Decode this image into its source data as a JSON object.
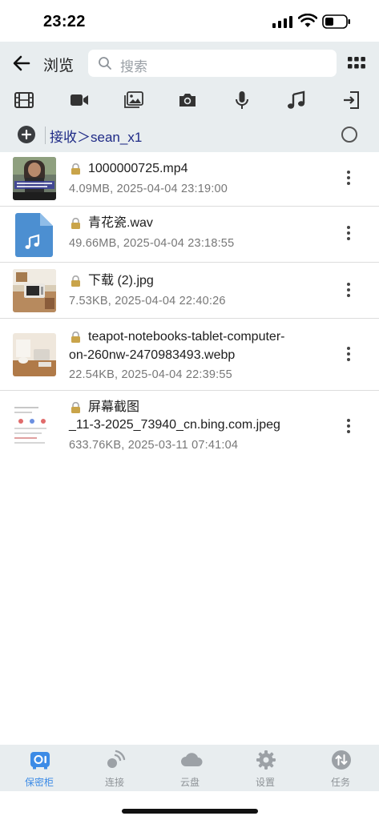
{
  "status_bar": {
    "time": "23:22"
  },
  "header": {
    "title": "浏览",
    "search_placeholder": "搜索"
  },
  "filter_icons": [
    "film-icon",
    "video-camera-icon",
    "image-icon",
    "camera-icon",
    "microphone-icon",
    "music-icon",
    "import-icon"
  ],
  "path": {
    "text": "接收＞sean_x1"
  },
  "files": [
    {
      "name": "1000000725.mp4",
      "meta": "4.09MB, 2025-04-04 23:19:00",
      "type": "video"
    },
    {
      "name": "青花瓷.wav",
      "meta": "49.66MB, 2025-04-04 23:18:55",
      "type": "audio"
    },
    {
      "name": "下载 (2).jpg",
      "meta": "7.53KB, 2025-04-04 22:40:26",
      "type": "image"
    },
    {
      "name_line1": "teapot-notebooks-tablet-computer-",
      "name_line2": "on-260nw-2470983493.webp",
      "meta": "22.54KB, 2025-04-04 22:39:55",
      "type": "image"
    },
    {
      "name_line1": "屏幕截图",
      "name_line2": "_11-3-2025_73940_cn.bing.com.jpeg",
      "meta": "633.76KB, 2025-03-11 07:41:04",
      "type": "image"
    }
  ],
  "bottom_nav": [
    {
      "label": "保密柜",
      "active": true
    },
    {
      "label": "连接",
      "active": false
    },
    {
      "label": "云盘",
      "active": false
    },
    {
      "label": "设置",
      "active": false
    },
    {
      "label": "任务",
      "active": false
    }
  ],
  "colors": {
    "accent": "#3c8be6",
    "path_text": "#1e2a86",
    "panel_bg": "#e8edef"
  }
}
